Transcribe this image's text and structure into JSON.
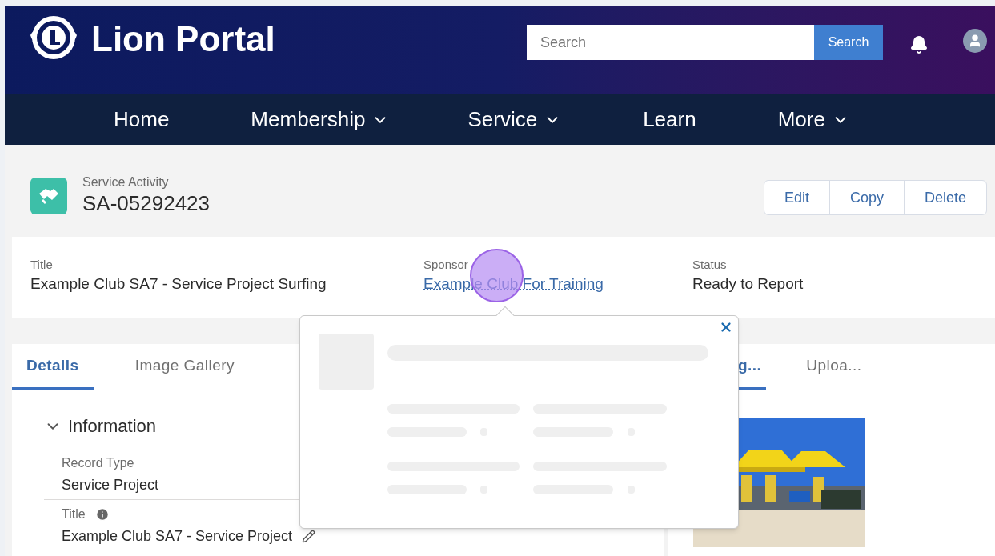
{
  "header": {
    "title": "Lion Portal",
    "search": {
      "placeholder": "Search",
      "button": "Search"
    }
  },
  "nav": [
    {
      "label": "Home",
      "dropdown": false
    },
    {
      "label": "Membership",
      "dropdown": true
    },
    {
      "label": "Service",
      "dropdown": true
    },
    {
      "label": "Learn",
      "dropdown": false
    },
    {
      "label": "More",
      "dropdown": true
    }
  ],
  "record": {
    "type": "Service Activity",
    "id": "SA-05292423",
    "actions": [
      "Edit",
      "Copy",
      "Delete"
    ]
  },
  "highlights": [
    {
      "label": "Title",
      "value": "Example Club SA7 - Service Project Surfing",
      "kind": "text"
    },
    {
      "label": "Sponsor",
      "value": "Example Club For Training",
      "kind": "link"
    },
    {
      "label": "Status",
      "value": "Ready to Report",
      "kind": "text"
    }
  ],
  "tabs": [
    {
      "label": "Details",
      "selected": true
    },
    {
      "label": "Image Gallery",
      "selected": false
    }
  ],
  "section": {
    "title": "Information",
    "expanded": true,
    "fields": [
      {
        "label": "Record Type",
        "value": "Service Project",
        "info": false,
        "editable": false
      },
      {
        "label": "Title",
        "value": "Example Club SA7 - Service Project",
        "info": true,
        "editable": true
      }
    ]
  },
  "side_tabs": [
    {
      "label": "g...",
      "selected": true
    },
    {
      "label": "Uploa...",
      "selected": false
    }
  ],
  "popover": {
    "open": true,
    "loading": true
  }
}
